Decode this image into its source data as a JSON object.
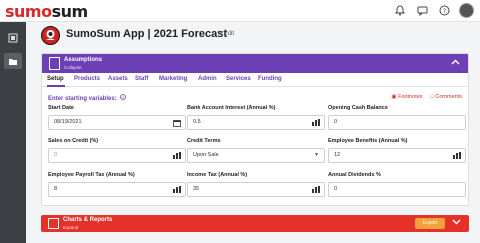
{
  "brand": {
    "part1": "sumo",
    "part2": "sum"
  },
  "header": {
    "title": "SumoSum App  |  2021 Forecast",
    "edit_label": "✎ Edit"
  },
  "assumptions": {
    "title": "Assumptions",
    "subtitle": "Collapse",
    "tabs": [
      "Setup",
      "Products",
      "Assets",
      "Staff",
      "Marketing",
      "Admin",
      "Services",
      "Funding"
    ],
    "section_title": "Enter starting variables:",
    "footnotes_label": "Footnotes",
    "comments_label": "Comments",
    "fields": [
      {
        "label": "Start Date",
        "value": "08/19/2021"
      },
      {
        "label": "Bank Account Interest (Annual %)",
        "value": "0.5"
      },
      {
        "label": "Opening Cash Balance",
        "value": "0"
      },
      {
        "label": "Sales on Credit (%)",
        "value": "0"
      },
      {
        "label": "Credit Terms",
        "value": "Upon Sale"
      },
      {
        "label": "Employee Benefits (Annual %)",
        "value": "12"
      },
      {
        "label": "Employee Payroll Tax (Annual %)",
        "value": "8"
      },
      {
        "label": "Income Tax (Annual %)",
        "value": "35"
      },
      {
        "label": "Annual Dividends %",
        "value": "0"
      }
    ]
  },
  "charts": {
    "title": "Charts & Reports",
    "subtitle": "Expand",
    "export_label": "Export"
  },
  "colors": {
    "brand_red": "#d62b2b",
    "accent_purple": "#6c3fb5",
    "charts_red": "#e4322b",
    "export_orange": "#f0a23a"
  },
  "icons": [
    "bell-icon",
    "chat-icon",
    "help-icon",
    "avatar",
    "layers-icon",
    "folder-icon",
    "calendar-icon",
    "bar-chart-icon",
    "chevron-up-icon",
    "chevron-down-icon"
  ]
}
